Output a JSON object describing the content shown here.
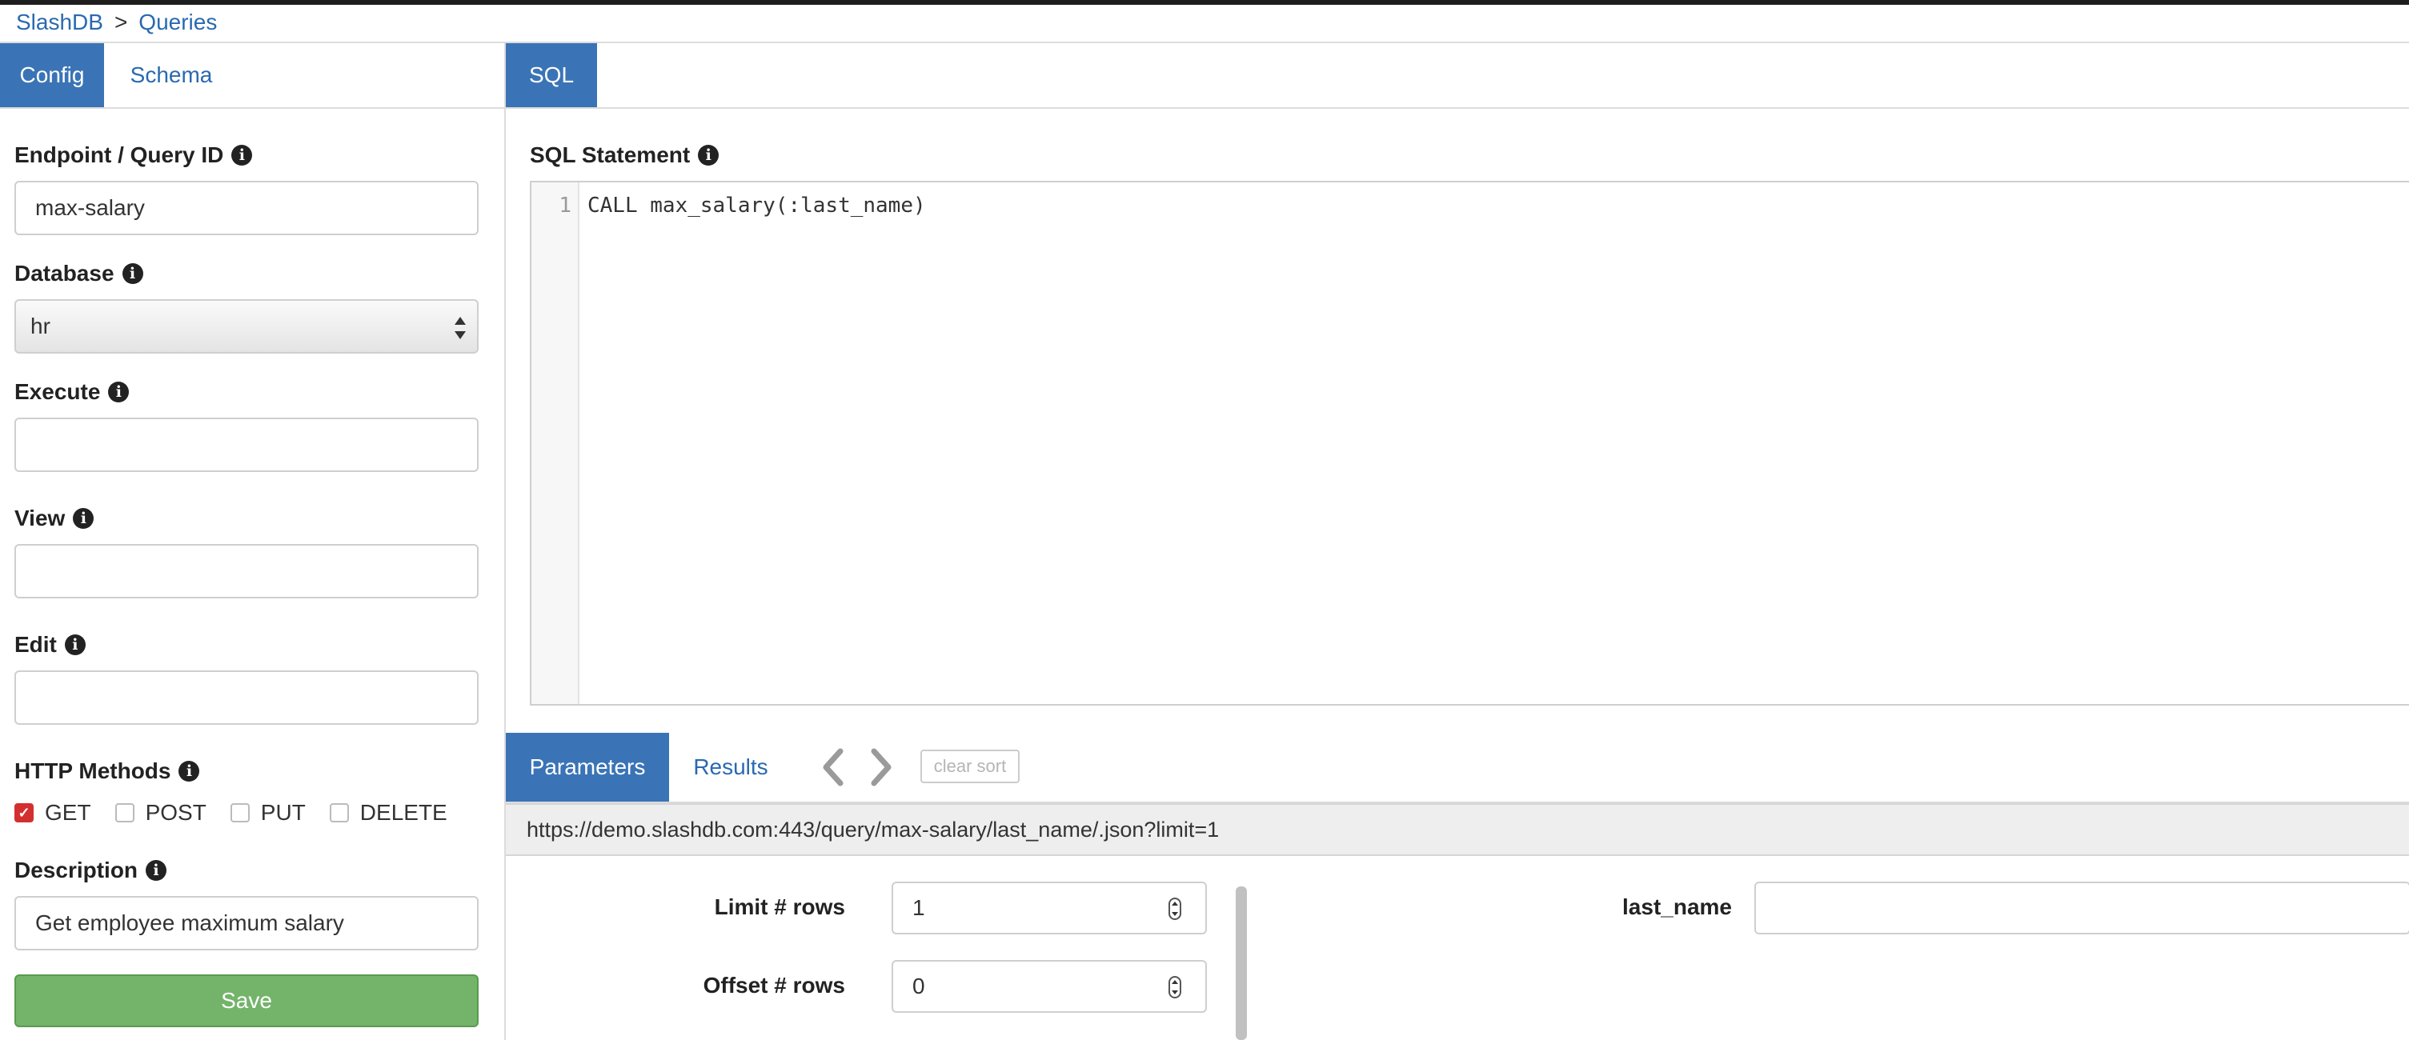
{
  "breadcrumb": {
    "root": "SlashDB",
    "separator": ">",
    "current": "Queries"
  },
  "left_tabs": [
    {
      "label": "Config"
    },
    {
      "label": "Schema"
    }
  ],
  "right_tabs": [
    {
      "label": "SQL"
    }
  ],
  "form": {
    "endpoint": {
      "label": "Endpoint / Query ID",
      "value": "max-salary"
    },
    "database": {
      "label": "Database",
      "value": "hr"
    },
    "execute": {
      "label": "Execute",
      "value": ""
    },
    "view": {
      "label": "View",
      "value": ""
    },
    "edit": {
      "label": "Edit",
      "value": ""
    },
    "http_methods": {
      "label": "HTTP Methods",
      "options": [
        {
          "label": "GET",
          "checked": true
        },
        {
          "label": "POST",
          "checked": false
        },
        {
          "label": "PUT",
          "checked": false
        },
        {
          "label": "DELETE",
          "checked": false
        }
      ]
    },
    "description": {
      "label": "Description",
      "value": "Get employee maximum salary"
    },
    "save_label": "Save"
  },
  "sql": {
    "label": "SQL Statement",
    "line_number": "1",
    "statement": "CALL max_salary(:last_name)"
  },
  "bottom_tabs": [
    {
      "label": "Parameters"
    },
    {
      "label": "Results"
    }
  ],
  "clear_sort_label": "clear sort",
  "url": "https://demo.slashdb.com:443/query/max-salary/last_name/.json?limit=1",
  "params": {
    "limit": {
      "label": "Limit # rows",
      "value": "1"
    },
    "offset": {
      "label": "Offset # rows",
      "value": "0"
    },
    "last_name": {
      "label": "last_name",
      "value": ""
    }
  },
  "colors": {
    "accent": "#3a74b6",
    "save": "#73b46a",
    "checked": "#d32f2f"
  },
  "icons": [
    "info-icon",
    "chevron-left-icon",
    "chevron-right-icon",
    "checkmark-icon",
    "select-arrows-icon",
    "spinner-arrows-icon"
  ]
}
